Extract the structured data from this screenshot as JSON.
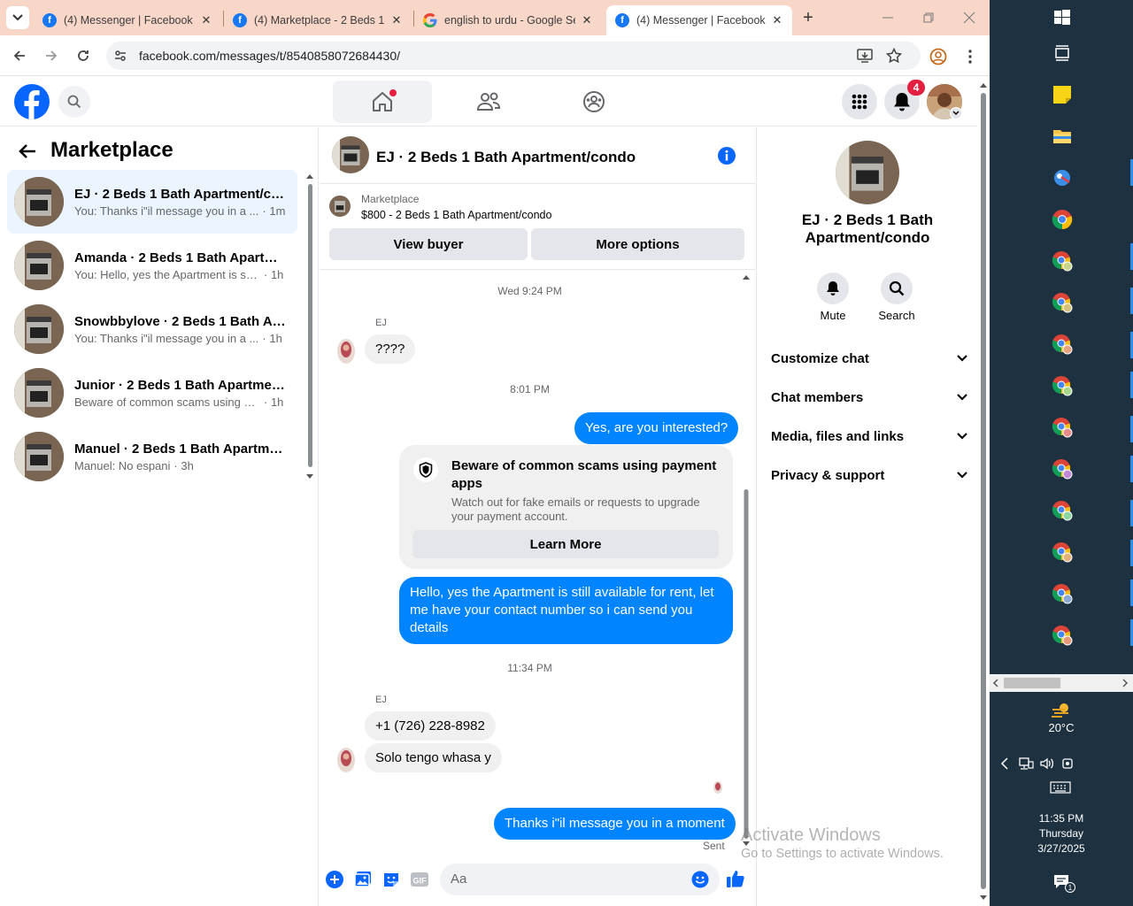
{
  "browser": {
    "tabs": [
      {
        "title": "(4) Messenger | Facebook",
        "icon": "facebook-icon",
        "active": false
      },
      {
        "title": "(4) Marketplace - 2 Beds 1",
        "icon": "facebook-icon",
        "active": false
      },
      {
        "title": "english to urdu - Google Se",
        "icon": "google-icon",
        "active": false
      },
      {
        "title": "(4) Messenger | Facebook",
        "icon": "facebook-icon",
        "active": true
      }
    ],
    "url": "facebook.com/messages/t/8540858072684430/"
  },
  "fb_header": {
    "notification_count": "4"
  },
  "left_panel": {
    "title": "Marketplace",
    "conversations": [
      {
        "name": "EJ · 2 Beds 1 Bath Apartment/co...",
        "preview": "You: Thanks i\"il message you in a ...",
        "time": "· 1m"
      },
      {
        "name": "Amanda · 2 Beds 1 Bath Apartm...",
        "preview": "You: Hello, yes the Apartment is stil...",
        "time": "· 1h"
      },
      {
        "name": "Snowbbylove · 2 Beds 1 Bath Ap...",
        "preview": "You: Thanks i\"il message you in a ...",
        "time": "· 1h"
      },
      {
        "name": "Junior · 2 Beds 1 Bath Apartmen...",
        "preview": "Beware of common scams using pa...",
        "time": "· 1h"
      },
      {
        "name": "Manuel · 2 Beds 1 Bath Apartme...",
        "preview": "Manuel: No espani",
        "time": "· 3h"
      }
    ]
  },
  "chat": {
    "title": "EJ · 2 Beds 1 Bath Apartment/condo",
    "listing": {
      "label": "Marketplace",
      "price_title": "$800 - 2 Beds 1 Bath Apartment/condo"
    },
    "view_buyer": "View buyer",
    "more_options": "More options",
    "messages": {
      "ts1": "Wed 9:24 PM",
      "sender1": "EJ",
      "m1": "????",
      "ts2": "8:01 PM",
      "m2": "Yes, are you interested?",
      "warn_title": "Beware of common scams using payment apps",
      "warn_body": "Watch out for fake emails or requests to upgrade your payment account.",
      "learn_more": "Learn More",
      "m3": "Hello, yes the Apartment is still available for rent, let me have your contact number so i can send you details",
      "ts3": "11:34 PM",
      "sender2": "EJ",
      "m4": "+1 (726) 228-8982",
      "m5": "Solo tengo whasa y",
      "m6": "Thanks i\"il message you in a moment",
      "status": "Sent"
    },
    "composer_placeholder": "Aa"
  },
  "right_panel": {
    "name": "EJ · 2 Beds 1 Bath Apartment/condo",
    "mute": "Mute",
    "search": "Search",
    "sections": [
      "Customize chat",
      "Chat members",
      "Media, files and links",
      "Privacy & support"
    ]
  },
  "watermark": {
    "line1": "Activate Windows",
    "line2": "Go to Settings to activate Windows."
  },
  "taskbar": {
    "temperature": "20°C",
    "time": "11:35 PM",
    "day": "Thursday",
    "date": "3/27/2025",
    "notif_count": "1"
  },
  "colors": {
    "fb_blue": "#0866ff",
    "bubble_out": "#0084ff",
    "tabbar": "#f8d7c9",
    "taskbar": "#1d3140"
  }
}
